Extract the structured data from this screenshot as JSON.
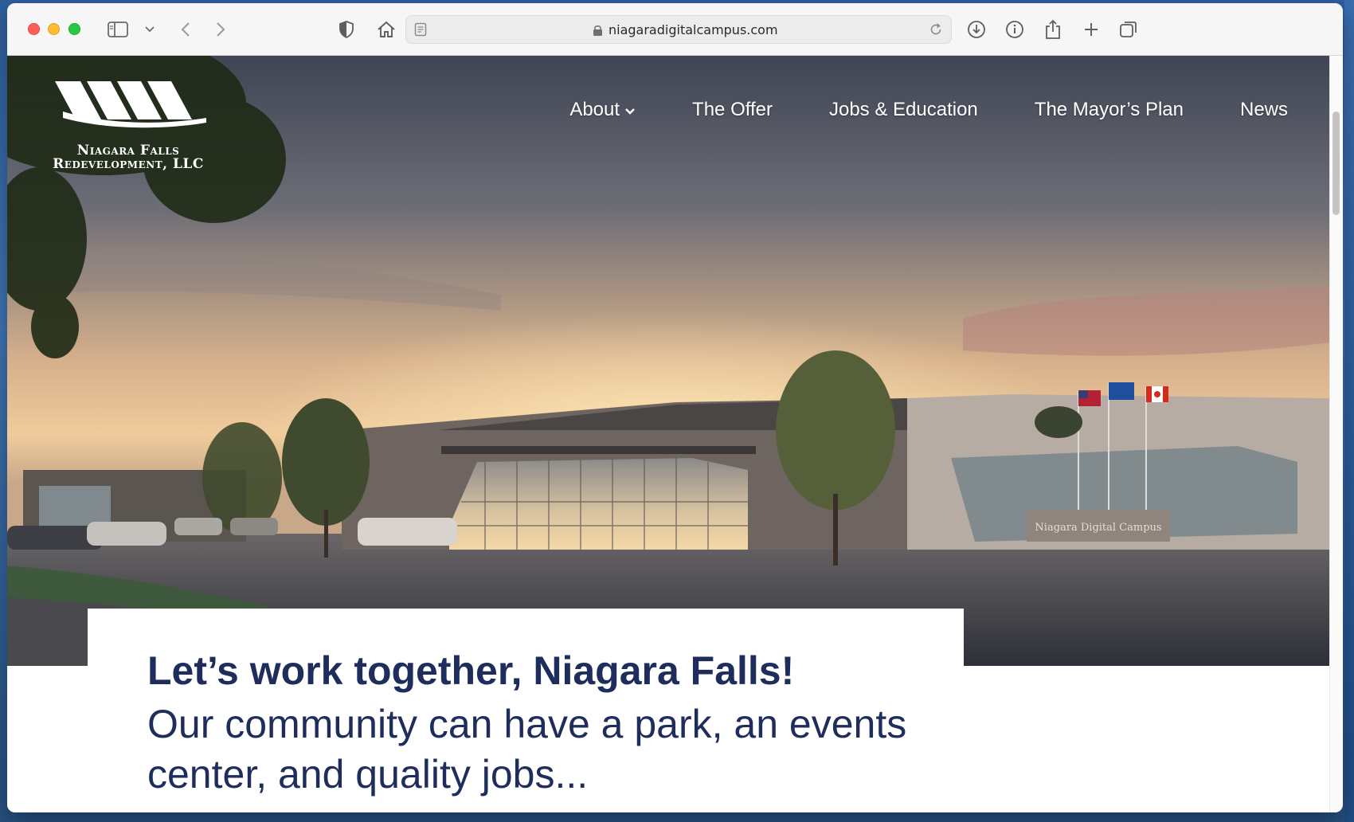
{
  "browser": {
    "url": "niagaradigitalcampus.com",
    "toolbar_icons": [
      "sidebar-icon",
      "chevron-down-icon",
      "back-icon",
      "forward-icon",
      "privacy-shield-icon",
      "home-icon",
      "reader-icon",
      "lock-icon",
      "reload-icon",
      "download-icon",
      "info-icon",
      "share-icon",
      "new-tab-icon",
      "tabs-overview-icon"
    ]
  },
  "site": {
    "logo_line1": "Niagara Falls",
    "logo_line2": "Redevelopment, LLC",
    "nav": {
      "about": "About",
      "offer": "The Offer",
      "jobs": "Jobs & Education",
      "mayor": "The Mayor’s Plan",
      "news": "News"
    },
    "hero_sign": "Niagara Digital Campus",
    "headline": "Let’s work together, Niagara Falls!",
    "subhead": "Our community can have a park, an events center, and quality jobs..."
  },
  "colors": {
    "heading": "#1f2d5c",
    "nav_text": "#ffffff"
  }
}
